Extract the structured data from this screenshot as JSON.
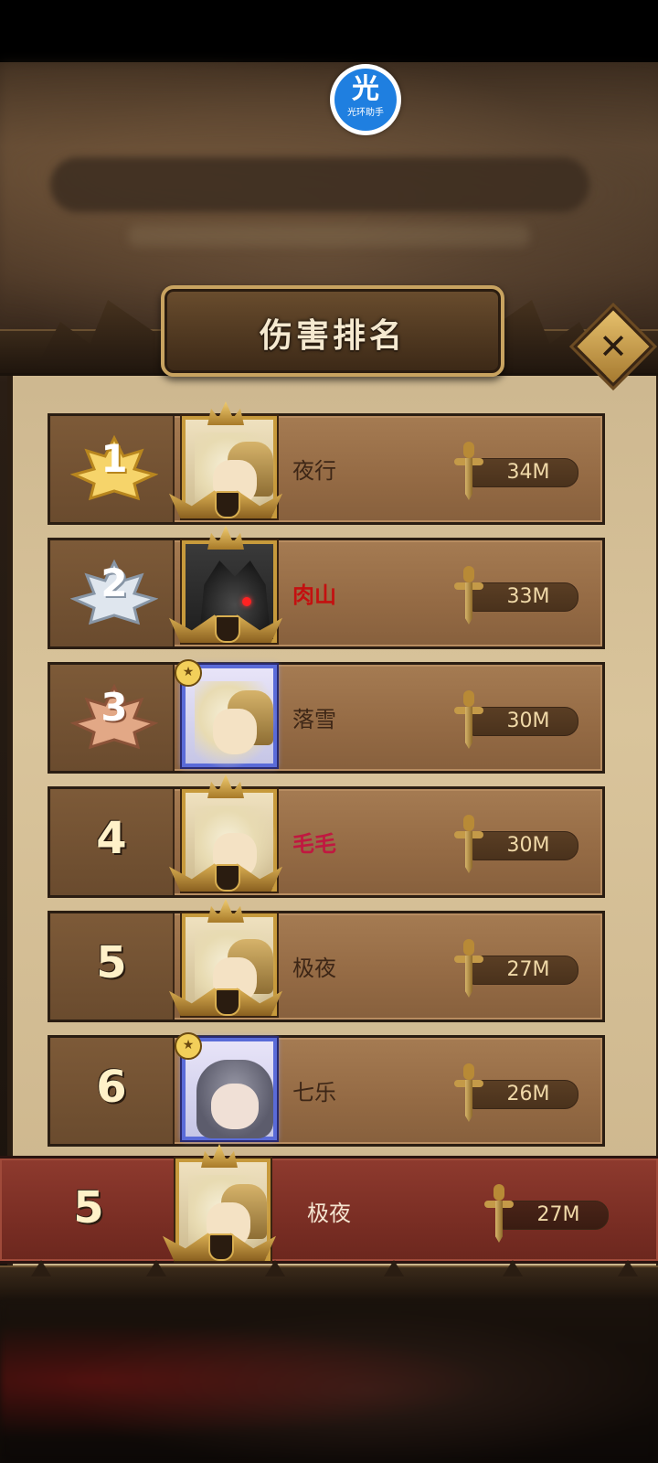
{
  "app_badge": {
    "glyph": "光",
    "label": "光环助手",
    "color": "#1f7fe0"
  },
  "panel": {
    "title": "伤害排名",
    "close_icon": "close-icon"
  },
  "ranking": [
    {
      "rank": "1",
      "medal": "gold",
      "name": "夜行",
      "name_color": "#3d2616",
      "damage": "34M",
      "frame": "gold",
      "portrait": "helmet-hero"
    },
    {
      "rank": "2",
      "medal": "silver",
      "name": "肉山",
      "name_color": "#c41010",
      "damage": "33M",
      "frame": "gold",
      "portrait": "dark-beast"
    },
    {
      "rank": "3",
      "medal": "bronze",
      "name": "落雪",
      "name_color": "#3d2616",
      "damage": "30M",
      "frame": "blue",
      "portrait": "helmet-hero"
    },
    {
      "rank": "4",
      "medal": "",
      "name": "毛毛",
      "name_color": "#c01840",
      "damage": "30M",
      "frame": "gold",
      "portrait": "blonde-hero"
    },
    {
      "rank": "5",
      "medal": "",
      "name": "极夜",
      "name_color": "#3d2616",
      "damage": "27M",
      "frame": "gold",
      "portrait": "helmet-hero"
    },
    {
      "rank": "6",
      "medal": "",
      "name": "七乐",
      "name_color": "#3d2616",
      "damage": "26M",
      "frame": "blue",
      "portrait": "gray-hair-girl"
    }
  ],
  "self": {
    "rank": "5",
    "name": "极夜",
    "damage": "27M"
  },
  "colors": {
    "gold_medal": "#e6b640",
    "silver_medal": "#b8c4d0",
    "bronze_medal": "#c08868",
    "self_row": "#7a2e24"
  }
}
